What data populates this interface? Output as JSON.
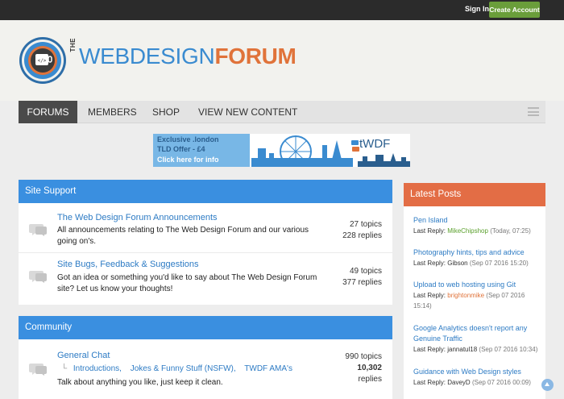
{
  "topbar": {
    "signin": "Sign In",
    "create": "Create Account"
  },
  "logo": {
    "the": "THE",
    "part_a": "WEBDESIGN",
    "part_b": "FORUM",
    "brand_blue": "#3a8bd0",
    "brand_orange": "#e0733a"
  },
  "nav": {
    "items": [
      "FORUMS",
      "MEMBERS",
      "SHOP",
      "VIEW NEW CONTENT"
    ],
    "active_index": 0
  },
  "banner": {
    "line1": "Exclusive .london",
    "line2": "TLD Offer - £4",
    "line3": "Click here for info",
    "brand": "tWDF"
  },
  "sections": [
    {
      "title": "Site Support",
      "forums": [
        {
          "title": "The Web Design Forum Announcements",
          "desc": "All announcements relating to The Web Design Forum and our various going on's.",
          "topics": "27 topics",
          "replies": "228 replies"
        },
        {
          "title": "Site Bugs, Feedback & Suggestions",
          "desc": "Got an idea or something you'd like to say about The Web Design Forum site? Let us know your thoughts!",
          "topics": "49 topics",
          "replies": "377 replies"
        }
      ]
    },
    {
      "title": "Community",
      "forums": [
        {
          "title": "General Chat",
          "subs": [
            "Introductions,",
            "Jokes & Funny Stuff (NSFW),",
            "TWDF AMA's"
          ],
          "desc": "Talk about anything you like, just keep it clean.",
          "topics": "990 topics",
          "replies_count": "10,302",
          "replies_word": "replies"
        }
      ]
    }
  ],
  "latest": {
    "title": "Latest Posts",
    "posts": [
      {
        "title": "Pen Island",
        "prefix": "Last Reply: ",
        "user": "MikeChipshop",
        "date": "(Today, 07:25)",
        "user_color": "#5aa02c"
      },
      {
        "title": "Photography hints, tips and advice",
        "prefix": "Last Reply: ",
        "user": "Gibson",
        "date": "(Sep 07 2016 15:20)",
        "user_color": "#333333"
      },
      {
        "title": "Upload to web hosting using Git",
        "prefix": "Last Reply: ",
        "user": "brightonmike",
        "date": "(Sep 07 2016 15:14)",
        "user_color": "#e0733a"
      },
      {
        "title": "Google Analytics doesn't report any Genuine Traffic",
        "prefix": "Last Reply: ",
        "user": "jannatul18",
        "date": "(Sep 07 2016 10:34)",
        "user_color": "#333333"
      },
      {
        "title": "Guidance with Web Design styles",
        "prefix": "Last Reply: ",
        "user": "DaveyD",
        "date": "(Sep 07 2016 00:09)",
        "user_color": "#333333"
      }
    ]
  },
  "colors": {
    "section_blue": "#3a8fe0",
    "latest_orange": "#e36d45",
    "link_blue": "#2d7bc4",
    "create_green": "#6a9e3a"
  }
}
